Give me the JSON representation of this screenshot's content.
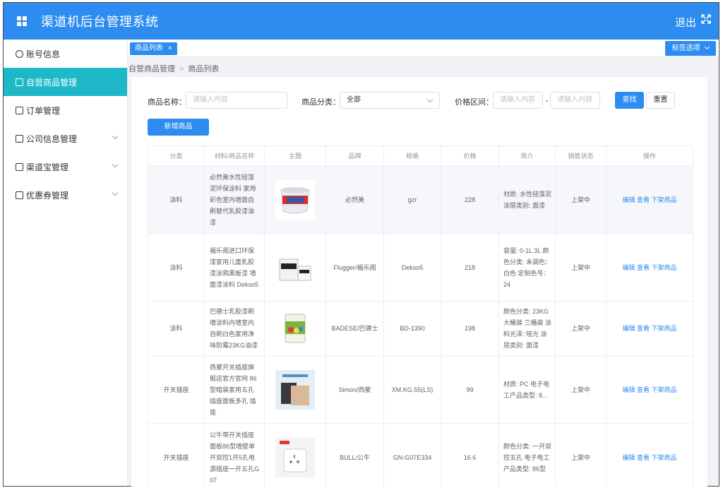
{
  "header": {
    "title": "渠道机后台管理系统",
    "logout": "退出"
  },
  "sidebar": {
    "items": [
      {
        "label": "账号信息",
        "icon": "user-circle-icon"
      },
      {
        "label": "自营商品管理",
        "icon": "bag-icon"
      },
      {
        "label": "订单管理",
        "icon": "list-icon"
      },
      {
        "label": "公司信息管理",
        "icon": "building-icon"
      },
      {
        "label": "渠道宝管理",
        "icon": "monitor-icon"
      },
      {
        "label": "优惠券管理",
        "icon": "monitor-icon"
      }
    ],
    "accent": "#1fb8c9"
  },
  "tags": {
    "active": "商品列表",
    "close": "×",
    "options": "标签选项"
  },
  "breadcrumb": {
    "parent": "自营商品管理",
    "current": "商品列表",
    "separator": ">"
  },
  "filters": {
    "name_label": "商品名称：",
    "name_placeholder": "请输入内容",
    "category_label": "商品分类：",
    "category_value": "全部",
    "price_label": "价格区间：",
    "price_min_placeholder": "请输入内容",
    "price_dash": "-",
    "price_max_placeholder": "请输入内容",
    "search": "查找",
    "reset": "重置",
    "add": "新增商品"
  },
  "table": {
    "columns": [
      "分类",
      "材料/商品名称",
      "主图",
      "品牌",
      "规格",
      "价格",
      "简介",
      "销售状态",
      "操作"
    ],
    "actions": {
      "edit": "编辑",
      "view": "查看",
      "offline": "下架商品"
    },
    "rows": [
      {
        "category": "涂料",
        "name": "必然美水性硅藻泥环保涂料 家用彩色室内墙面自刷替代乳胶漆油漆",
        "brand": "必然美",
        "spec": "gzr",
        "price": "228",
        "desc": "材质: 水性硅藻泥 涂层类别: 面漆",
        "status": "上架中"
      },
      {
        "category": "涂料",
        "name": "福乐阁进口环保漆家用儿童乳胶漆涂鸦黑板漆 墙面漆涂料 Dekso5",
        "brand": "Flugger/福乐阁",
        "spec": "Dekso5",
        "price": "218",
        "desc": "容量: 0-1L 3L 颜色分类: 未调色：白色 定制色号：24",
        "status": "上架中"
      },
      {
        "category": "涂料",
        "name": "巴德士乳胶漆刷墙涂料内墙室内自刷白色家用净味防霉23KG油漆",
        "brand": "BADESE/巴德士",
        "spec": "BD-1390",
        "price": "198",
        "desc": "颜色分类: 23KG大桶装 三桶装 涂料光泽: 哑光 涂层类别: 面漆",
        "status": "上架中"
      },
      {
        "category": "开关插座",
        "name": "西蒙开关插座旗舰店官方官网 86型暗装家用五孔插座面板多孔 插座",
        "brand": "Simon/西蒙",
        "spec": "XM.KG.55(LS)",
        "price": "99",
        "desc": "材质: PC 电子电工产品类型: 8...",
        "status": "上架中"
      },
      {
        "category": "开关插座",
        "name": "公牛带开关插座面板86型墙壁单开双控1开5孔电源插座一开五孔G07",
        "brand": "BULL/公牛",
        "spec": "GN-G07E334",
        "price": "16.6",
        "desc": "颜色分类: 一开双控五孔 电子电工产品类型: 86型",
        "status": "上架中"
      }
    ]
  },
  "colors": {
    "primary": "#2d8cf0",
    "status_green": "#19be6b"
  }
}
